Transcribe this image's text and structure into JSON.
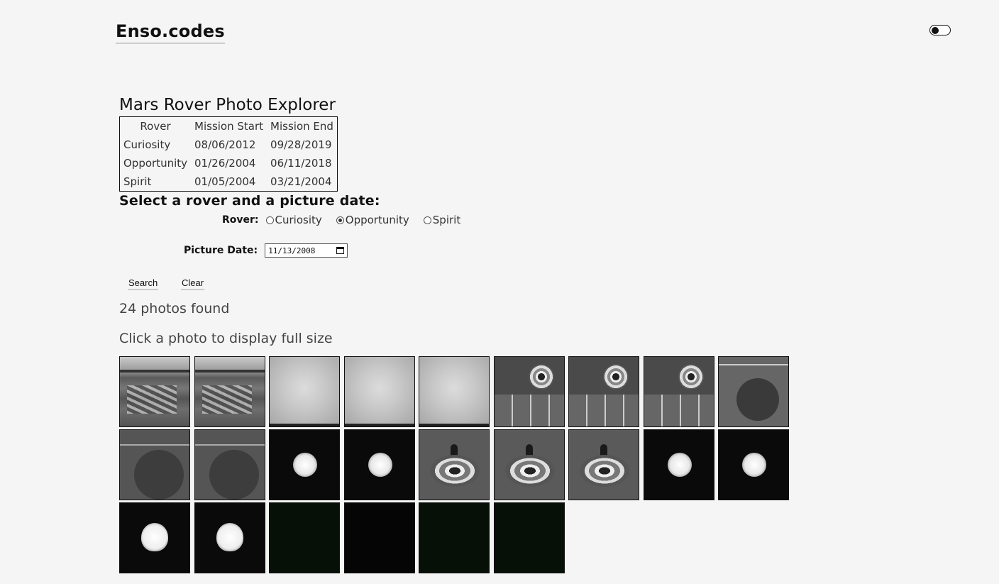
{
  "header": {
    "logo": "Enso.codes",
    "theme_toggle": "dark-mode-toggle"
  },
  "page": {
    "title": "Mars Rover Photo Explorer"
  },
  "missions": {
    "headers": [
      "Rover",
      "Mission Start",
      "Mission End"
    ],
    "rows": [
      [
        "Curiosity",
        "08/06/2012",
        "09/28/2019"
      ],
      [
        "Opportunity",
        "01/26/2004",
        "06/11/2018"
      ],
      [
        "Spirit",
        "01/05/2004",
        "03/21/2004"
      ]
    ]
  },
  "form": {
    "heading": "Select a rover and a picture date:",
    "rover_label": "Rover:",
    "rovers": [
      {
        "label": "Curiosity",
        "selected": false
      },
      {
        "label": "Opportunity",
        "selected": true
      },
      {
        "label": "Spirit",
        "selected": false
      }
    ],
    "date_label": "Picture Date:",
    "date_value": "11/13/2008",
    "search_label": "Search",
    "clear_label": "Clear"
  },
  "results": {
    "count_text": "24 photos found",
    "hint": "Click a photo to display full size",
    "photos": [
      "landscape",
      "landscape",
      "haze",
      "haze",
      "haze",
      "deck",
      "deck",
      "deck",
      "disc",
      "disc2",
      "disc2",
      "sun",
      "sun",
      "target",
      "target",
      "target",
      "sun",
      "sun",
      "blob",
      "blob",
      "dark",
      "black",
      "dark",
      "dark"
    ]
  }
}
